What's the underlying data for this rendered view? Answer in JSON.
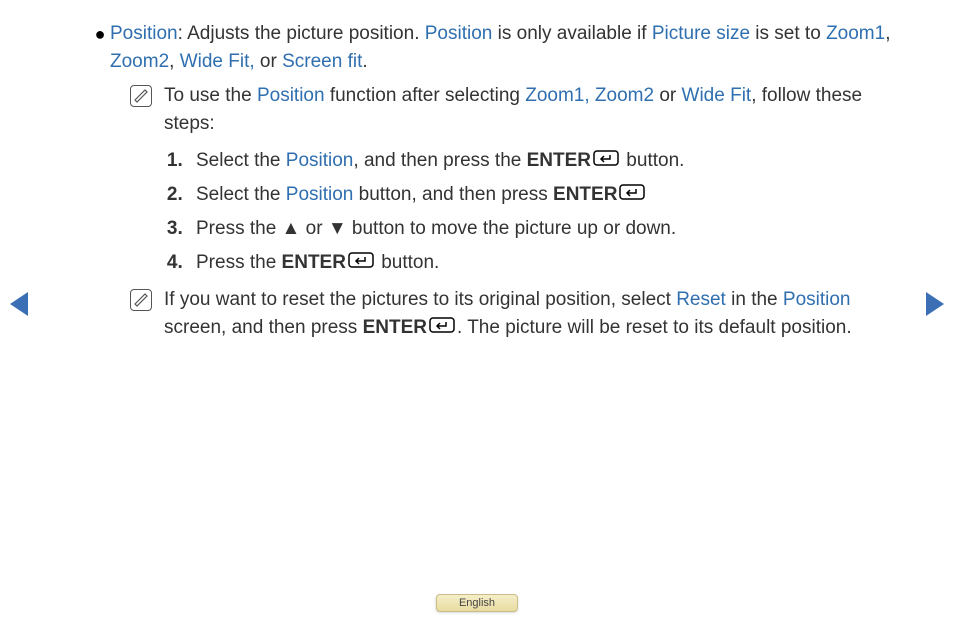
{
  "bullet": {
    "position": "Position",
    "t1": ": Adjusts the picture position. ",
    "position2": "Position",
    "t2": " is only available if ",
    "psize": "Picture size",
    "t3": " is set to ",
    "z1": "Zoom1",
    "c1": ", ",
    "z2": "Zoom2",
    "c2": ", ",
    "wf": "Wide Fit,",
    "or": " or ",
    "sf": "Screen fit",
    "dot": "."
  },
  "note1": {
    "t1": "To use the ",
    "pos": "Position",
    "t2": " function after selecting ",
    "z12": "Zoom1, Zoom2",
    "or": " or ",
    "wf": "Wide Fit",
    "t3": ", follow these steps:"
  },
  "steps": {
    "s1a": "Select the ",
    "s1pos": "Position",
    "s1b": ", and then press the ",
    "s1enter": "ENTER",
    "s1c": " button.",
    "s2a": "Select the ",
    "s2pos": "Position",
    "s2b": " button, and then press ",
    "s2enter": "ENTER",
    "s3a": "Press the ",
    "up": "▲",
    "s3or": " or ",
    "down": "▼",
    "s3b": " button to move the picture up or down.",
    "s4a": "Press the ",
    "s4enter": "ENTER",
    "s4b": " button."
  },
  "note2": {
    "t1": "If you want to reset the pictures to its original position, select ",
    "reset": "Reset",
    "t2": " in the ",
    "pos": "Position",
    "t3": " screen, and then press ",
    "enter": "ENTER",
    "t4": ". The picture will be reset to its default position."
  },
  "footer": {
    "lang": "English"
  },
  "dot": "●"
}
